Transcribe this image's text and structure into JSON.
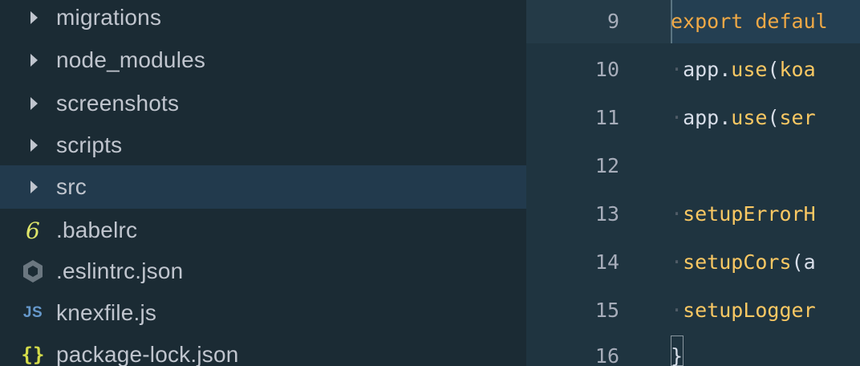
{
  "sidebar": {
    "items": [
      {
        "label": "migrations",
        "type": "folder",
        "selected": false
      },
      {
        "label": "node_modules",
        "type": "folder",
        "selected": false
      },
      {
        "label": "screenshots",
        "type": "folder",
        "selected": false
      },
      {
        "label": "scripts",
        "type": "folder",
        "selected": false
      },
      {
        "label": "src",
        "type": "folder",
        "selected": true
      },
      {
        "label": ".babelrc",
        "type": "file",
        "icon": "babel-icon",
        "glyph": "6"
      },
      {
        "label": ".eslintrc.json",
        "type": "file",
        "icon": "eslint-icon"
      },
      {
        "label": "knexfile.js",
        "type": "file",
        "icon": "js-file-icon",
        "glyph": "JS"
      },
      {
        "label": "package-lock.json",
        "type": "file",
        "icon": "json-file-icon",
        "glyph": "{}"
      }
    ]
  },
  "editor": {
    "lines": [
      {
        "number": "9",
        "indent": "",
        "parts": [
          "export",
          " ",
          "defaul"
        ]
      },
      {
        "number": "10",
        "indent": "·",
        "parts": [
          "app",
          ".",
          "use",
          "(",
          "koa"
        ]
      },
      {
        "number": "11",
        "indent": "·",
        "parts": [
          "app",
          ".",
          "use",
          "(",
          "ser"
        ]
      },
      {
        "number": "12",
        "indent": "",
        "parts": []
      },
      {
        "number": "13",
        "indent": "·",
        "parts": [
          "setupErrorH"
        ]
      },
      {
        "number": "14",
        "indent": "·",
        "parts": [
          "setupCors",
          "(",
          "a"
        ]
      },
      {
        "number": "15",
        "indent": "·",
        "parts": [
          "setupLogger"
        ]
      },
      {
        "number": "16",
        "indent": "",
        "parts": [
          "}"
        ]
      }
    ]
  },
  "colors": {
    "sidebar_bg": "#1b2b34",
    "selected_row": "#223a4d",
    "editor_bg": "#1f3440",
    "keyword": "#f0a946",
    "function": "#fac863",
    "text": "#d8dee9"
  }
}
